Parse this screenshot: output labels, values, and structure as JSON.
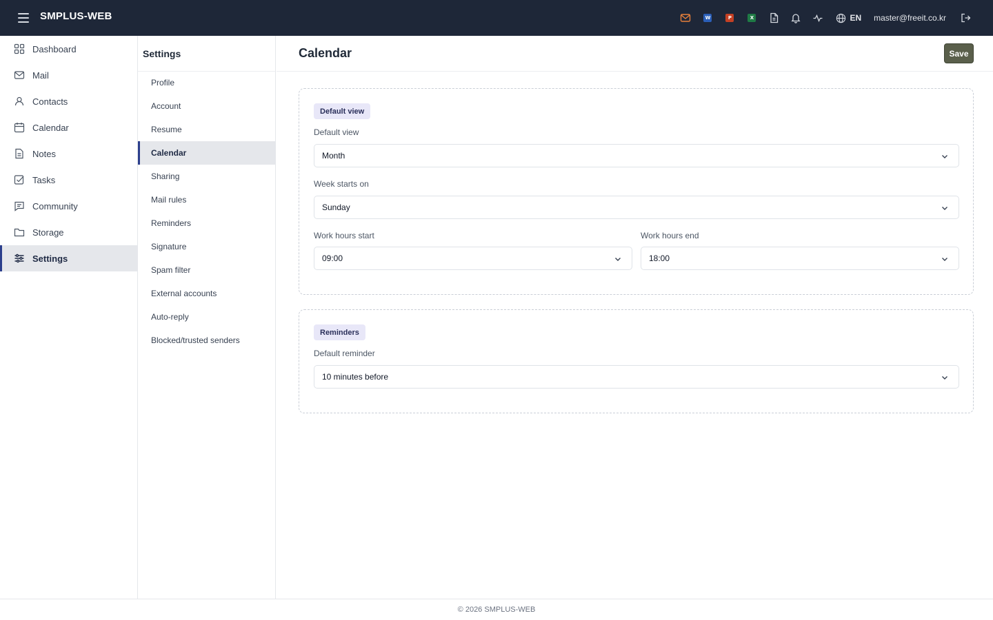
{
  "app": {
    "brand": "SMPLUS-WEB"
  },
  "topbar": {
    "icons": [
      "mail-icon",
      "word-icon",
      "powerpoint-icon",
      "excel-icon",
      "document-icon",
      "bell-icon",
      "activity-icon",
      "globe-icon",
      "logout-icon"
    ],
    "office": {
      "word": "W",
      "powerpoint": "P",
      "excel": "X"
    },
    "colors": {
      "mail": "#e8803a",
      "word": "#2b5fb8",
      "powerpoint": "#c44024",
      "excel": "#1f7a45"
    },
    "language": "EN",
    "user_email": "master@freeit.co.kr"
  },
  "sidebar": {
    "items": [
      {
        "label": "Dashboard",
        "icon": "grid-icon"
      },
      {
        "label": "Mail",
        "icon": "mail-icon"
      },
      {
        "label": "Contacts",
        "icon": "user-icon"
      },
      {
        "label": "Calendar",
        "icon": "calendar-icon"
      },
      {
        "label": "Notes",
        "icon": "note-icon"
      },
      {
        "label": "Tasks",
        "icon": "checkbox-icon"
      },
      {
        "label": "Community",
        "icon": "chat-icon"
      },
      {
        "label": "Storage",
        "icon": "folder-icon"
      },
      {
        "label": "Settings",
        "icon": "sliders-icon"
      }
    ],
    "active": "Settings"
  },
  "settings_menu": {
    "title": "Settings",
    "items": [
      "Profile",
      "Account",
      "Resume",
      "Calendar",
      "Sharing",
      "Mail rules",
      "Reminders",
      "Signature",
      "Spam filter",
      "External accounts",
      "Auto-reply",
      "Blocked/trusted senders"
    ],
    "active": "Calendar"
  },
  "main": {
    "title": "Calendar",
    "save_label": "Save",
    "sections": {
      "default_view": {
        "badge": "Default view",
        "default_view_label": "Default view",
        "default_view_value": "Month",
        "week_starts_label": "Week starts on",
        "week_starts_value": "Sunday",
        "work_start_label": "Work hours start",
        "work_start_value": "09:00",
        "work_end_label": "Work hours end",
        "work_end_value": "18:00"
      },
      "reminders": {
        "badge": "Reminders",
        "default_reminder_label": "Default reminder",
        "default_reminder_value": "10 minutes before"
      }
    }
  },
  "footer": {
    "text": "© 2026 SMPLUS-WEB"
  },
  "colors": {
    "topbar": "#1e2738",
    "accent": "#2c3f8c",
    "save_button": "#5a5f4b",
    "badge_bg": "#e8e7f8"
  }
}
